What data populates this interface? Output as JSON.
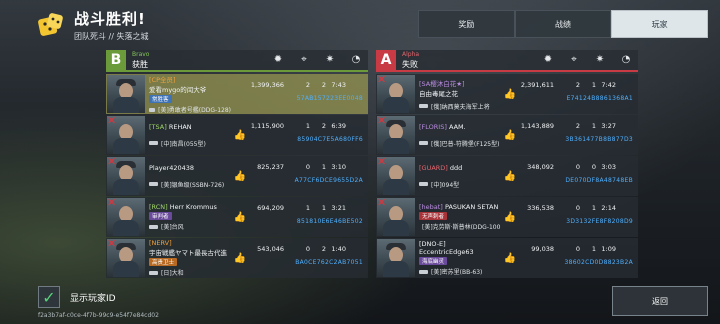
{
  "header": {
    "title": "战斗胜利!",
    "subtitle": "团队死斗 // 失落之城"
  },
  "tabs": [
    {
      "label": "奖励",
      "active": false
    },
    {
      "label": "战绩",
      "active": false
    },
    {
      "label": "玩家",
      "active": true
    }
  ],
  "teams": {
    "blue": {
      "letter": "B",
      "name": "Bravo",
      "result": "获胜",
      "players": [
        {
          "rank": "",
          "clan": "[CP全员]",
          "name": "爱看mygo的闰大爷",
          "badge": "常胜客",
          "ship": "[美]勇敢者号艦(DDG-128)",
          "score": "1,399,366",
          "kills": "2",
          "assists": "2",
          "time": "7:43",
          "id": "57AB157223EE0048",
          "dead": false,
          "highlight": true
        },
        {
          "rank": "",
          "clan": "[TSA]",
          "name": "REHAN",
          "badge": "",
          "ship": "[中]南昌(055型)",
          "score": "1,115,900",
          "kills": "1",
          "assists": "2",
          "time": "6:39",
          "id": "85904C7E5A680FF6",
          "dead": true,
          "highlight": false
        },
        {
          "rank": "",
          "clan": "",
          "name": "Player420438",
          "badge": "",
          "ship": "[美]银鱼级(SSBN-726)",
          "score": "825,237",
          "kills": "0",
          "assists": "1",
          "time": "3:10",
          "id": "A77CF6DCE9655D2A",
          "dead": true,
          "highlight": false
        },
        {
          "rank": "",
          "clan": "[RCN]",
          "name": "Herr Krommus",
          "badge": "审判者",
          "ship": "[美]台风",
          "score": "694,209",
          "kills": "1",
          "assists": "1",
          "time": "3:21",
          "id": "851810E6E46BE502",
          "dead": true,
          "highlight": false
        },
        {
          "rank": "",
          "clan": "[NERV]",
          "name": "宇宙戦艦ヤマト最長古代進",
          "badge": "高贵卫士",
          "ship": "[日]大和",
          "score": "543,046",
          "kills": "0",
          "assists": "2",
          "time": "1:40",
          "id": "BA0CE762C2AB7051",
          "dead": true,
          "highlight": false
        }
      ]
    },
    "red": {
      "letter": "A",
      "name": "Alpha",
      "result": "失败",
      "players": [
        {
          "rank": "",
          "clan": "[SA樱沐白花★]",
          "name": "自由毒尾之花",
          "badge": "",
          "ship": "[俄]纳西莫夫海军上将",
          "score": "2,391,611",
          "kills": "2",
          "assists": "1",
          "time": "7:42",
          "id": "E74124B8861368A1",
          "dead": true,
          "highlight": false
        },
        {
          "rank": "",
          "clan": "[FLORIS]",
          "name": "AAM.",
          "badge": "",
          "ship": "[俄]巴普-符腾堡(F125型)",
          "score": "1,143,889",
          "kills": "2",
          "assists": "1",
          "time": "3:27",
          "id": "3B361477B8B877D3",
          "dead": true,
          "highlight": false
        },
        {
          "rank": "",
          "clan": "[GUARD]",
          "name": "ddd",
          "badge": "",
          "ship": "[中]094型",
          "score": "348,092",
          "kills": "0",
          "assists": "0",
          "time": "3:03",
          "id": "DE070DF8A48748EB",
          "dead": true,
          "highlight": false
        },
        {
          "rank": "",
          "clan": "[hebat]",
          "name": "PASUKAN SETAN",
          "badge": "无声刺者",
          "ship": "[美]克劳斯·斯普林(DDG-1001)",
          "score": "336,538",
          "kills": "0",
          "assists": "1",
          "time": "2:14",
          "id": "3D3132FE8F8208D9",
          "dead": true,
          "highlight": false
        },
        {
          "rank": "",
          "clan": "[DNO-E]",
          "name": "EccentricEdge63",
          "badge": "海底幽灵",
          "ship": "[美]密苏里(BB-63)",
          "score": "99,038",
          "kills": "0",
          "assists": "1",
          "time": "1:09",
          "id": "38602CD0D8823B2A",
          "dead": false,
          "highlight": false
        }
      ]
    }
  },
  "footer": {
    "show_id_label": "显示玩家ID",
    "show_id_checked": true,
    "uuid": "f2a3b7af-c0ce-4f7b-99c9-e54f7e84cd02",
    "back_label": "返回"
  },
  "colors": {
    "blue_team": "#6b9a3a",
    "red_team": "#c83a44",
    "player_id": "#4fb0ff"
  }
}
